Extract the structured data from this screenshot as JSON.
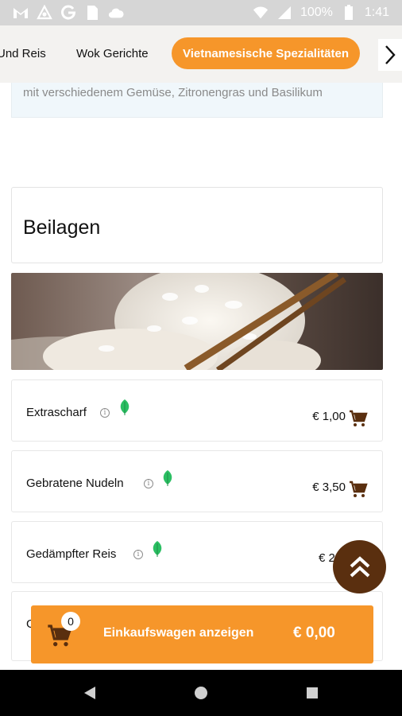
{
  "status_bar": {
    "battery_percent": "100%",
    "time": "1:41",
    "left_icons": [
      "gmail-icon",
      "ring-icon",
      "google-icon",
      "sim-icon",
      "cloud-icon"
    ],
    "right_icons": [
      "wifi-icon",
      "signal-icon",
      "battery-icon"
    ]
  },
  "category_tabs": {
    "items": [
      "Und Reis",
      "Wok Gerichte",
      "Vietnamesische Spezialitäten"
    ],
    "active_index": 2,
    "next_icon": "chevron-right-icon"
  },
  "previous_item": {
    "description": "mit verschiedenem Gemüse, Zitronengras und Basilikum"
  },
  "section": {
    "title": "Beilagen",
    "banner_image": "rice-with-chopsticks"
  },
  "items": [
    {
      "name": "Extrascharf",
      "price": "€ 1,00",
      "vegetarian": true
    },
    {
      "name": "Gebratene Nudeln",
      "price": "€ 3,50",
      "vegetarian": true
    },
    {
      "name": "Gedämpfter Reis",
      "price": "€ 2,",
      "vegetarian": true
    },
    {
      "name": "G",
      "price": "",
      "vegetarian": false
    }
  ],
  "cart": {
    "count": "0",
    "label": "Einkaufswagen anzeigen",
    "total": "€ 0,00"
  },
  "colors": {
    "accent": "#f6962a",
    "dark_brown": "#5a2f0f",
    "leaf_green": "#2bbf63",
    "cart_icon": "#5a2f0f"
  },
  "nav_bar": {
    "buttons": [
      "back-icon",
      "home-icon",
      "recents-icon"
    ]
  }
}
